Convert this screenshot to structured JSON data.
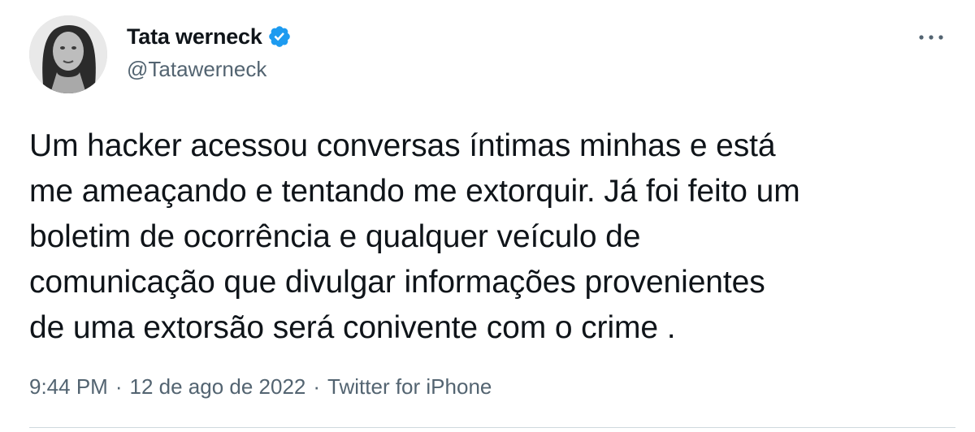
{
  "author": {
    "display_name": "Tata werneck",
    "handle": "@Tatawerneck",
    "verified": true,
    "avatar_icon": "avatar-photo"
  },
  "more_menu": {
    "icon": "more-horizontal-icon"
  },
  "tweet": {
    "text": "Um hacker acessou conversas íntimas minhas e está\nme ameaçando e tentando me extorquir. Já foi feito um\nboletim de ocorrência e qualquer veículo de\ncomunicação que divulgar informações provenientes\nde uma extorsão será conivente com o crime ."
  },
  "meta": {
    "time": "9:44 PM",
    "date": "12 de ago de 2022",
    "source": "Twitter for iPhone",
    "separator": "·"
  },
  "colors": {
    "text_primary": "#0f1419",
    "text_secondary": "#536471",
    "verified_blue": "#1d9bf0",
    "divider": "#cfd9de"
  }
}
